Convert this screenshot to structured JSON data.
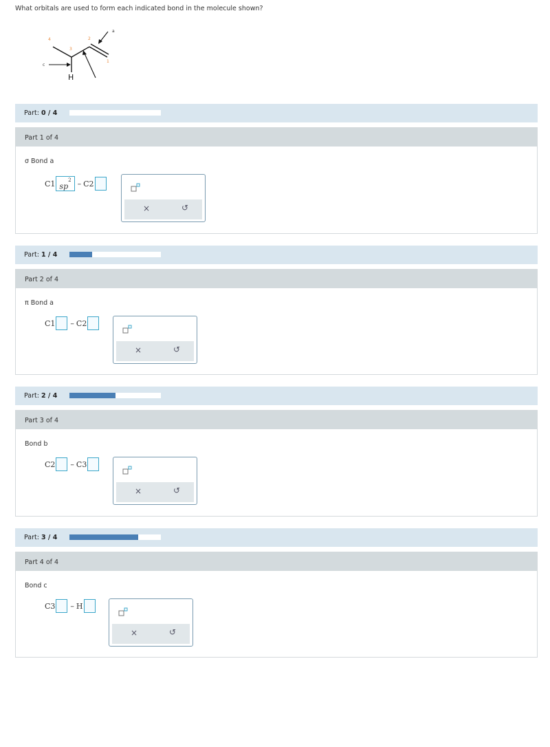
{
  "question": "What orbitals are used to form each indicated bond in the molecule shown?",
  "molecule": {
    "atom_numbers": [
      "4",
      "3",
      "2",
      "1"
    ],
    "bond_labels": [
      "a",
      "c"
    ],
    "atom_label_h": "H"
  },
  "progress": [
    {
      "label": "Part:",
      "value": "0 / 4",
      "fraction": 0.0
    },
    {
      "label": "Part:",
      "value": "1 / 4",
      "fraction": 0.25
    },
    {
      "label": "Part:",
      "value": "2 / 4",
      "fraction": 0.5
    },
    {
      "label": "Part:",
      "value": "3 / 4",
      "fraction": 0.75
    }
  ],
  "parts": [
    {
      "header": "Part 1 of 4",
      "bond": "σ Bond a",
      "left_atom": "C1",
      "right_atom": "C2",
      "left_value": "sp",
      "left_sup": "2"
    },
    {
      "header": "Part 2 of 4",
      "bond": "π Bond a",
      "left_atom": "C1",
      "right_atom": "C2"
    },
    {
      "header": "Part 3 of 4",
      "bond": "Bond b",
      "left_atom": "C2",
      "right_atom": "C3"
    },
    {
      "header": "Part 4 of 4",
      "bond": "Bond c",
      "left_atom": "C3",
      "right_atom": "H"
    }
  ],
  "symbols": {
    "dash": "–",
    "clear": "×",
    "undo": "↺"
  },
  "colors": {
    "accent": "#3ba6c9",
    "progress": "#4a7fb5",
    "number": "#e8883a"
  }
}
